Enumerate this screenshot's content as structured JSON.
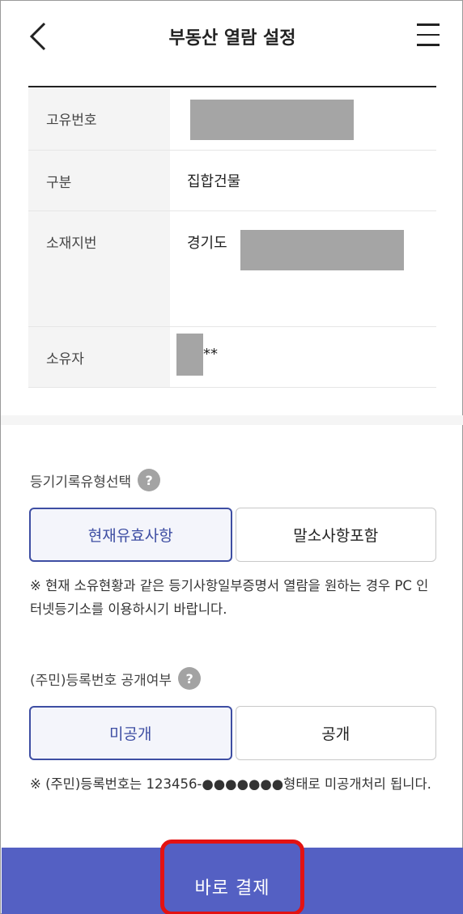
{
  "header": {
    "title": "부동산 열람 설정"
  },
  "info": {
    "rows": [
      {
        "label": "고유번호",
        "value": ""
      },
      {
        "label": "구분",
        "value": "집합건물"
      },
      {
        "label": "소재지번",
        "value": "경기도"
      },
      {
        "label": "소유자",
        "value": "**"
      }
    ]
  },
  "record_type": {
    "label": "등기기록유형선택",
    "help": "?",
    "options": [
      "현재유효사항",
      "말소사항포함"
    ],
    "selected": "현재유효사항",
    "note": "※ 현재 소유현황과 같은 등기사항일부증명서 열람을 원하는 경우 PC 인터넷등기소를 이용하시기 바랍니다."
  },
  "id_disclosure": {
    "label": "(주민)등록번호 공개여부",
    "help": "?",
    "options": [
      "미공개",
      "공개"
    ],
    "selected": "미공개",
    "note": "※ (주민)등록번호는 123456-●●●●●●●형태로 미공개처리 됩니다."
  },
  "footer": {
    "pay_label": "바로 결제"
  },
  "colors": {
    "accent": "#3e4ea3",
    "pay_bar": "#5460c3",
    "highlight_box": "#e31212",
    "mask": "#a5a5a5"
  }
}
